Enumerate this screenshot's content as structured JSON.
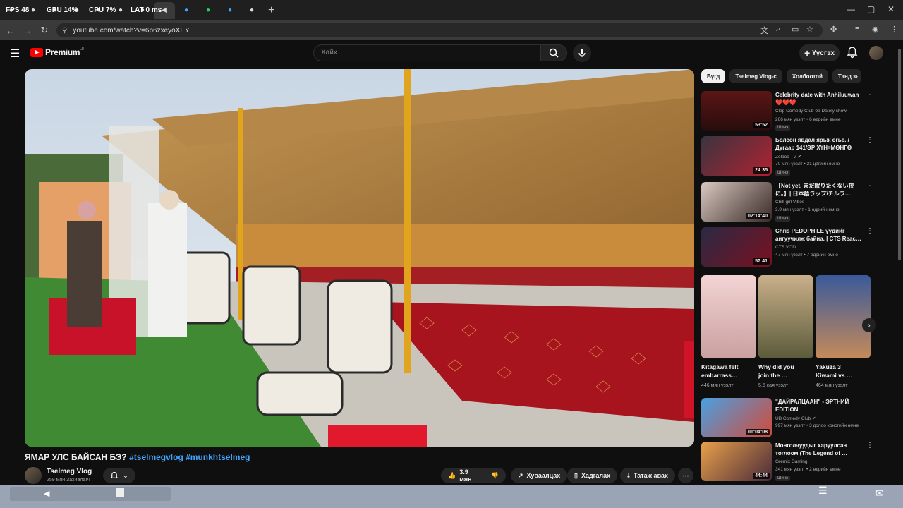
{
  "overlay": {
    "fps_label": "FPS",
    "fps_value": "48",
    "gpu_label": "GPU",
    "gpu_value": "14%",
    "cpu_label": "CPU",
    "cpu_value": "7%",
    "lat_label": "LAT",
    "lat_value": "0 ms"
  },
  "browser": {
    "url": "youtube.com/watch?v=6p6zxeyoXEY"
  },
  "yt": {
    "logo": "Premium",
    "logo_region": "JP",
    "search_placeholder": "Хайх",
    "create_label": "Үүсгэх"
  },
  "video": {
    "title": "ЯМАР УЛС БАЙСАН БЭ?",
    "hashtags": "#tselmegvlog #munkhtselmeg",
    "channel": "Tselmeg Vlog",
    "subscribers": "259 мян Захиалагч",
    "likes": "3.9 мян",
    "share": "Хуваалцах",
    "save": "Хадгалах",
    "download": "Татаж авах"
  },
  "chips": [
    "Бүгд",
    "Tselmeg Vlog-с",
    "Холбоотой",
    "Танд з"
  ],
  "recommendations": [
    {
      "title": "Celebrity date with Anhiluuwan ❤️❤️❤️",
      "channel": "Clap Comedy Club бa Dately show",
      "meta": "266 мян үзэлт • 6 өдрийн өмнө",
      "badge": "Шинэ",
      "duration": "53:52"
    },
    {
      "title": "Болсон явдал ярьж өгье. / Дугаар 141/ЭР ХҮН=МӨНГӨ",
      "channel": "Zolboo TV ✔",
      "meta": "70 мян үзэлт • 21 цагийн өмнө",
      "badge": "Шинэ",
      "duration": "24:35"
    },
    {
      "title": "【Not yet. まだ眠りたくない夜に。】| 日本語ラップ/チルラ…",
      "channel": "Chill girl Vibes",
      "meta": "3.9 мян үзэлт • 1 өдрийн өмнө",
      "badge": "Шинэ",
      "duration": "02:14:40"
    },
    {
      "title": "Chris PEDOPHILE үүдийг ангуучилж байна. | CTS Reac…",
      "channel": "CTS VOD",
      "meta": "47 мян үзэлт • 7 өдрийн өмнө",
      "badge": "",
      "duration": "57:41"
    }
  ],
  "shorts": [
    {
      "title": "Kitagawa felt embarrass…",
      "views": "446 мян үзэлт"
    },
    {
      "title": "Why did you join the …",
      "views": "5.5 сая үзэлт"
    },
    {
      "title": "Yakuza 3 Kiwami vs …",
      "views": "464 мян үзэлт"
    }
  ],
  "recommendations2": [
    {
      "title": "\"ДАЙРАЛЦААН\" - ЭРТНИЙ EDITION",
      "channel": "UB Comedy Club ✔",
      "meta": "997 мян үзэлт • 3 долоо хоногийн өмнө",
      "badge": "",
      "duration": "01:04:08"
    },
    {
      "title": "Монголчуудыг харуулсан тоглоом (The Legend of …",
      "channel": "Gremix Gaming",
      "meta": "341 мян үзэлт • 2 өдрийн өмнө",
      "badge": "Шинэ",
      "duration": "44:44"
    }
  ],
  "icons": [
    "menu-icon",
    "search-icon",
    "mic-icon",
    "plus-icon",
    "bell-icon",
    "like-icon",
    "dislike-icon",
    "share-icon",
    "save-icon",
    "download-icon",
    "more-icon"
  ],
  "colors": {
    "yt_red": "#ff0000",
    "link_blue": "#3ea6ff",
    "bg": "#0f0f0f",
    "pill": "#272727"
  }
}
